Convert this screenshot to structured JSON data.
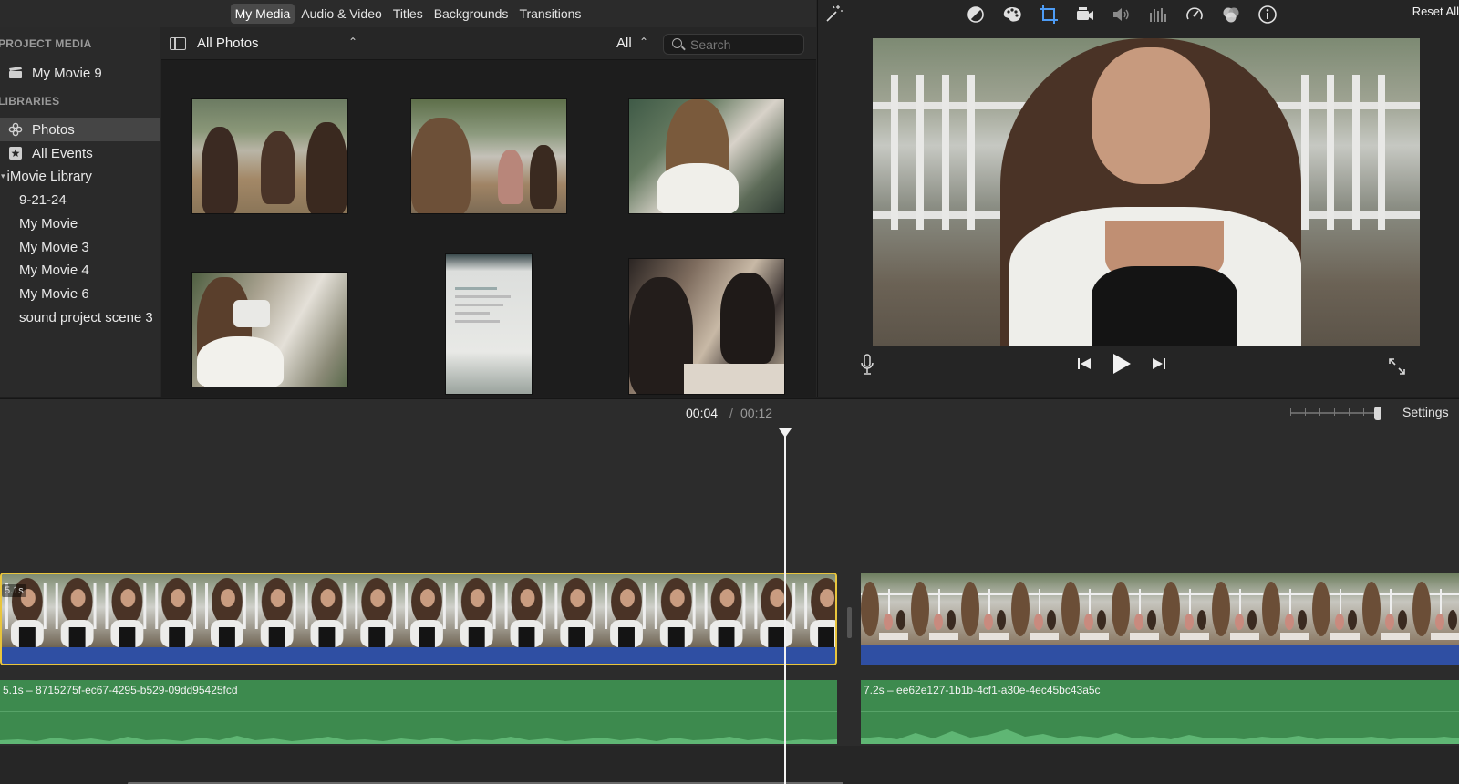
{
  "media_tabs": [
    "My Media",
    "Audio & Video",
    "Titles",
    "Backgrounds",
    "Transitions"
  ],
  "media_tabs_active": "My Media",
  "sidebar": {
    "project_media_heading": "PROJECT MEDIA",
    "project_item": "My Movie 9",
    "libraries_heading": "LIBRARIES",
    "photos": "Photos",
    "all_events": "All Events",
    "library_name": "iMovie Library",
    "events": [
      "9-21-24",
      "My Movie",
      "My Movie 3",
      "My Movie 4",
      "My Movie 6",
      "sound project scene 3"
    ]
  },
  "browser": {
    "album": "All Photos",
    "filter": "All",
    "search_placeholder": "Search"
  },
  "viewer": {
    "reset_label": "Reset All",
    "adjust_icons": [
      "color-balance-icon",
      "color-correction-icon",
      "crop-icon",
      "stabilization-icon",
      "volume-icon",
      "noise-reduction-icon",
      "speed-icon",
      "clip-filter-icon",
      "info-icon"
    ]
  },
  "timeline": {
    "current_time": "00:04",
    "separator": "/",
    "total_time": "00:12",
    "settings_label": "Settings",
    "clip1": {
      "duration_badge": "5.1s",
      "audio_label": "5.1s – 8715275f-ec67-4295-b529-09dd95425fcd"
    },
    "clip2": {
      "audio_label": "7.2s – ee62e127-1b1b-4cf1-a30e-4ec45bc43a5c"
    }
  },
  "colors": {
    "selection": "#e9c53c",
    "audio_track": "#3d8a4e",
    "clip_audio_bar": "#2f4fa3"
  }
}
